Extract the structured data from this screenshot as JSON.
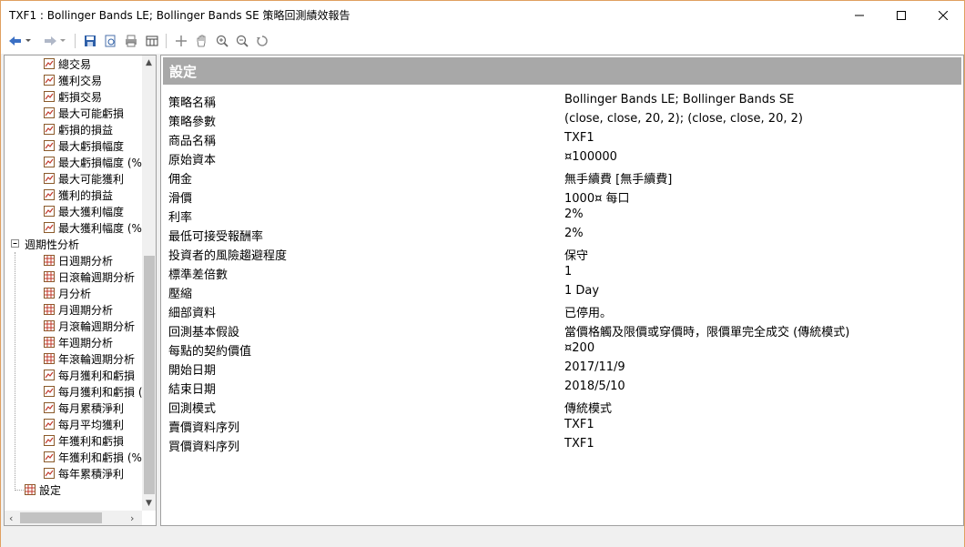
{
  "window": {
    "title": "TXF1 : Bollinger Bands LE; Bollinger Bands SE 策略回測績效報告",
    "minimize": "—",
    "maximize": "☐",
    "close": "✕"
  },
  "toolbar": {
    "icons": [
      "back-icon",
      "back-dropdown-icon",
      "forward-icon",
      "forward-dropdown-icon",
      "save-icon",
      "print-preview-icon",
      "print-icon",
      "table-icon",
      "crosshair-icon",
      "hand-pan-icon",
      "zoom-in-icon",
      "zoom-out-icon",
      "reset-zoom-icon"
    ]
  },
  "tree": {
    "items": [
      {
        "label": "總交易",
        "icon": "chart-icon"
      },
      {
        "label": "獲利交易",
        "icon": "chart-icon"
      },
      {
        "label": "虧損交易",
        "icon": "chart-icon"
      },
      {
        "label": "最大可能虧損",
        "icon": "chart-icon"
      },
      {
        "label": "虧損的損益",
        "icon": "chart-icon"
      },
      {
        "label": "最大虧損幅度",
        "icon": "chart-icon"
      },
      {
        "label": "最大虧損幅度 (%",
        "icon": "chart-icon"
      },
      {
        "label": "最大可能獲利",
        "icon": "chart-icon"
      },
      {
        "label": "獲利的損益",
        "icon": "chart-icon"
      },
      {
        "label": "最大獲利幅度",
        "icon": "chart-icon"
      },
      {
        "label": "最大獲利幅度 (%",
        "icon": "chart-icon"
      },
      {
        "label": "週期性分析",
        "icon": "collapse-icon",
        "group": true
      },
      {
        "label": "日週期分析",
        "icon": "grid-icon"
      },
      {
        "label": "日滾輪週期分析",
        "icon": "grid-icon"
      },
      {
        "label": "月分析",
        "icon": "grid-icon"
      },
      {
        "label": "月週期分析",
        "icon": "grid-icon"
      },
      {
        "label": "月滾輪週期分析",
        "icon": "grid-icon"
      },
      {
        "label": "年週期分析",
        "icon": "grid-icon"
      },
      {
        "label": "年滾輪週期分析",
        "icon": "grid-icon"
      },
      {
        "label": "每月獲利和虧損",
        "icon": "chart-icon"
      },
      {
        "label": "每月獲利和虧損 (",
        "icon": "chart-icon"
      },
      {
        "label": "每月累積淨利",
        "icon": "chart-icon"
      },
      {
        "label": "每月平均獲利",
        "icon": "chart-icon"
      },
      {
        "label": "年獲利和虧損",
        "icon": "chart-icon"
      },
      {
        "label": "年獲利和虧損 (%",
        "icon": "chart-icon"
      },
      {
        "label": "每年累積淨利",
        "icon": "chart-icon"
      },
      {
        "label": "設定",
        "icon": "grid-icon",
        "top": true
      }
    ]
  },
  "content": {
    "header": "設定",
    "rows": [
      {
        "label": "策略名稱",
        "value": "Bollinger Bands LE; Bollinger Bands SE"
      },
      {
        "label": "策略參數",
        "value": "(close,  close,  20,  2); (close,  close,  20,  2)"
      },
      {
        "label": "商品名稱",
        "value": "TXF1"
      },
      {
        "label": "原始資本",
        "value": "¤100000"
      },
      {
        "label": "佣金",
        "value": "無手續費 [無手續費]"
      },
      {
        "label": "滑價",
        "value": "1000¤ 每口"
      },
      {
        "label": "利率",
        "value": "2%"
      },
      {
        "label": "最低可接受報酬率",
        "value": "2%"
      },
      {
        "label": "投資者的風險趨避程度",
        "value": "保守"
      },
      {
        "label": "標準差倍數",
        "value": "1"
      },
      {
        "label": "壓縮",
        "value": "1 Day"
      },
      {
        "label": "細部資料",
        "value": "已停用。"
      },
      {
        "label": "回測基本假設",
        "value": "當價格觸及限價或穿價時，限價單完全成交 (傳統模式)"
      },
      {
        "label": "每點的契約價值",
        "value": "¤200"
      },
      {
        "label": "開始日期",
        "value": "2017/11/9"
      },
      {
        "label": "結束日期",
        "value": "2018/5/10"
      },
      {
        "label": "回測模式",
        "value": "傳統模式"
      },
      {
        "label": "賣價資料序列",
        "value": "TXF1"
      },
      {
        "label": "買價資料序列",
        "value": "TXF1"
      }
    ]
  }
}
